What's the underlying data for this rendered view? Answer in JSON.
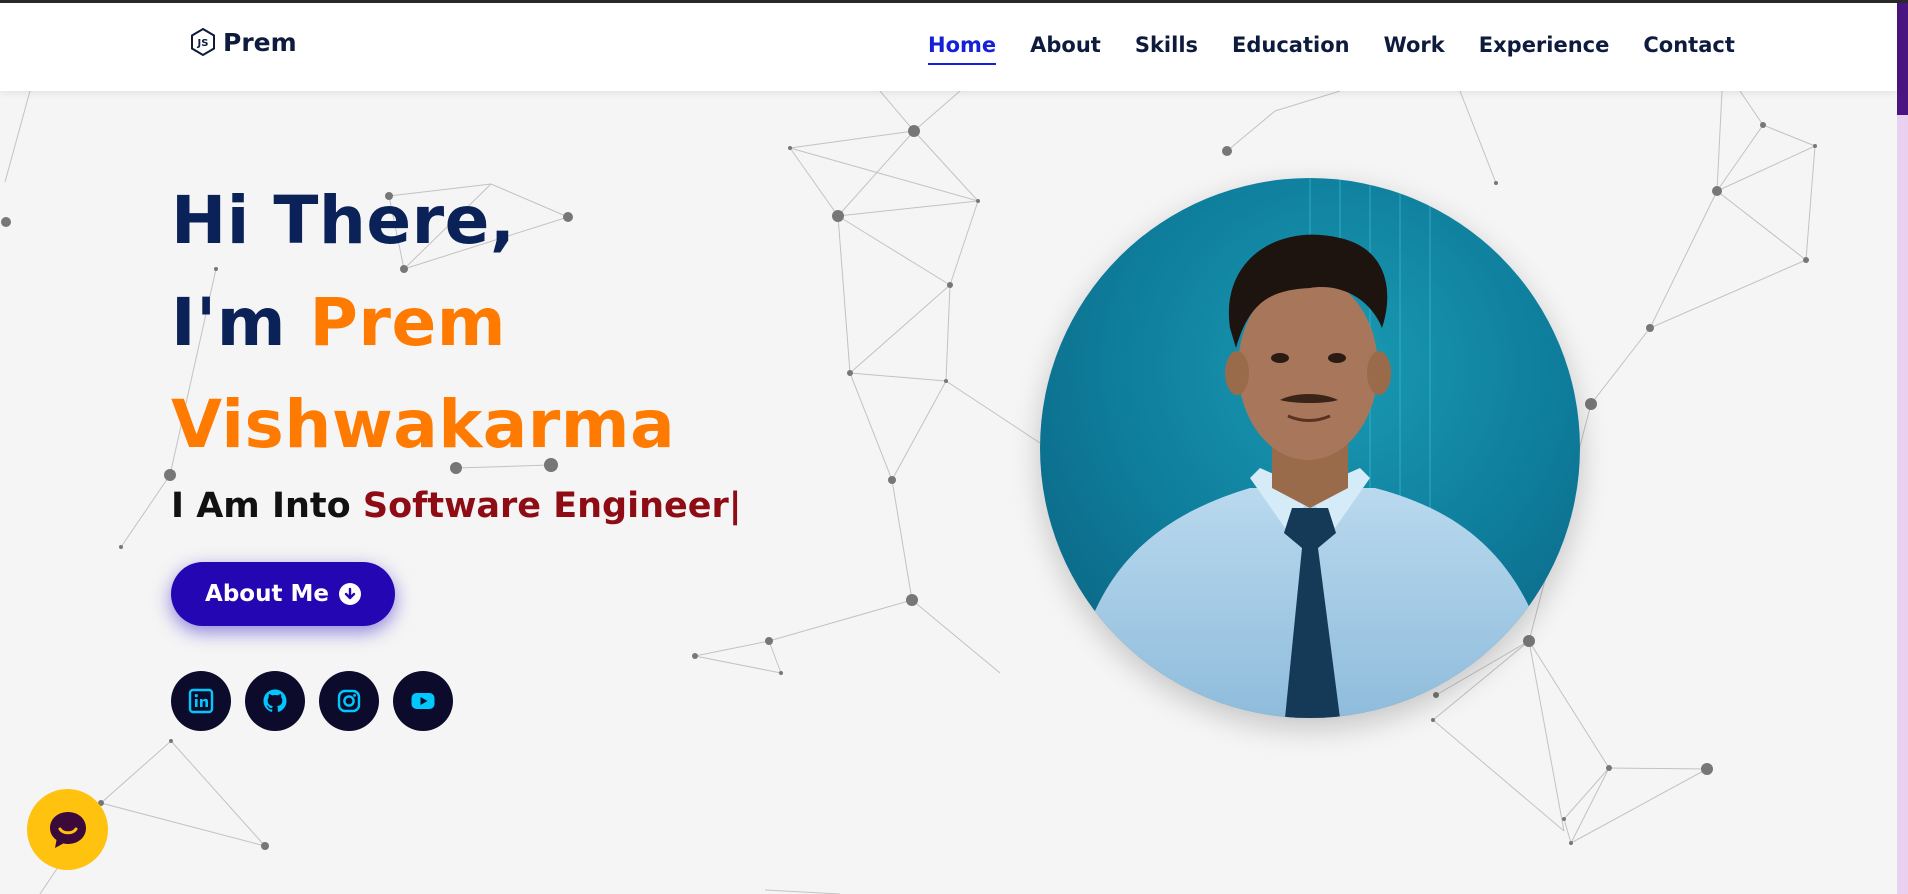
{
  "brand": {
    "name": "Prem",
    "logo_icon": "nodejs-hex-icon"
  },
  "nav": {
    "links": [
      {
        "label": "Home",
        "active": true
      },
      {
        "label": "About",
        "active": false
      },
      {
        "label": "Skills",
        "active": false
      },
      {
        "label": "Education",
        "active": false
      },
      {
        "label": "Work",
        "active": false
      },
      {
        "label": "Experience",
        "active": false
      },
      {
        "label": "Contact",
        "active": false
      }
    ]
  },
  "hero": {
    "greeting": "Hi There,",
    "im_prefix": "I'm",
    "first_name": "Prem",
    "last_name": "Vishwakarma",
    "into_prefix": "I Am Into",
    "role": "Software Engineer",
    "caret": "|"
  },
  "about_button": {
    "label": "About Me",
    "icon": "arrow-down-circle-icon"
  },
  "socials": [
    {
      "name": "linkedin",
      "icon": "linkedin-icon"
    },
    {
      "name": "github",
      "icon": "github-icon"
    },
    {
      "name": "instagram",
      "icon": "instagram-icon"
    },
    {
      "name": "youtube",
      "icon": "youtube-icon"
    }
  ],
  "chat_widget": {
    "icon": "chat-bubble-icon"
  },
  "colors": {
    "navy": "#0b2259",
    "accent_orange": "#ff7a00",
    "role_red": "#8e0d14",
    "button_blue": "#2406b3",
    "nav_active": "#1520d8",
    "social_bg": "#0d0b2b",
    "social_icon": "#00c8ff",
    "chat_yellow": "#ffc20e"
  }
}
